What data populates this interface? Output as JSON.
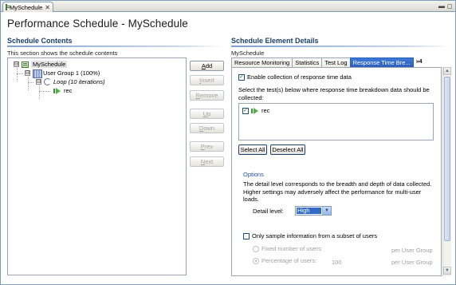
{
  "editor_tab": {
    "label": "MySchedule",
    "close_glyph": "✕",
    "icon": "schedule-icon"
  },
  "window_controls": {
    "minimize": "▬",
    "maximize": "◻"
  },
  "page_title": "Performance Schedule - MySchedule",
  "left": {
    "heading": "Schedule Contents",
    "description": "This section shows the schedule contents",
    "tree": [
      {
        "label": "MySchedule",
        "icon": "schedule-icon",
        "toggle": "⊟",
        "selected": true
      },
      {
        "label": "User Group 1 (100%)",
        "icon": "user-group-icon",
        "toggle": "⊟"
      },
      {
        "label": "Loop (10 iterations)",
        "icon": "loop-icon",
        "toggle": "⊟",
        "italic": true
      },
      {
        "label": "rec",
        "icon": "test-icon"
      }
    ],
    "buttons": [
      {
        "label": "Add",
        "mnemonic": "A",
        "rest": "dd",
        "enabled": true
      },
      {
        "label": "Insert",
        "mnemonic": "I",
        "rest": "nsert",
        "enabled": false
      },
      {
        "label": "Remove",
        "mnemonic": "R",
        "rest": "emove",
        "enabled": false
      },
      {
        "label": "Up",
        "mnemonic": "U",
        "rest": "p",
        "enabled": false
      },
      {
        "label": "Down",
        "mnemonic": "D",
        "rest": "own",
        "enabled": false
      },
      {
        "label": "Prev",
        "mnemonic": "P",
        "rest": "rev",
        "enabled": false
      },
      {
        "label": "Next",
        "mnemonic": "N",
        "rest": "ext",
        "enabled": false
      }
    ]
  },
  "right": {
    "heading": "Schedule Element Details",
    "element_name": "MySchedule",
    "tabs": [
      {
        "label": "Resource Monitoring"
      },
      {
        "label": "Statistics"
      },
      {
        "label": "Test Log"
      },
      {
        "label": "Response Time Bre...",
        "active": true
      }
    ],
    "more_tabs": "»4",
    "enable_label": "Enable collection of response time data",
    "enable_checked": true,
    "select_tests_line1": "Select the test(s) below where response time breakdown data should be",
    "select_tests_line2": "collected:",
    "tests": [
      {
        "label": "rec",
        "checked": true
      }
    ],
    "select_all": "Select All",
    "deselect_all": "Deselect All",
    "options_heading": "Options",
    "detail_text_1": "The detail level corresponds to the breadth and depth of data collected.",
    "detail_text_2": "Higher settings may adversely affect the performance for multi-user",
    "detail_text_3": "loads.",
    "detail_level_label": "Detail level:",
    "detail_level_value": "High",
    "sample_label": "Only sample information from a subset of users",
    "sample_checked": false,
    "fixed_number_label": "Fixed number of users:",
    "percentage_label": "Percentage of users:",
    "percentage_value": "100",
    "per_user_group": "per User Group"
  }
}
